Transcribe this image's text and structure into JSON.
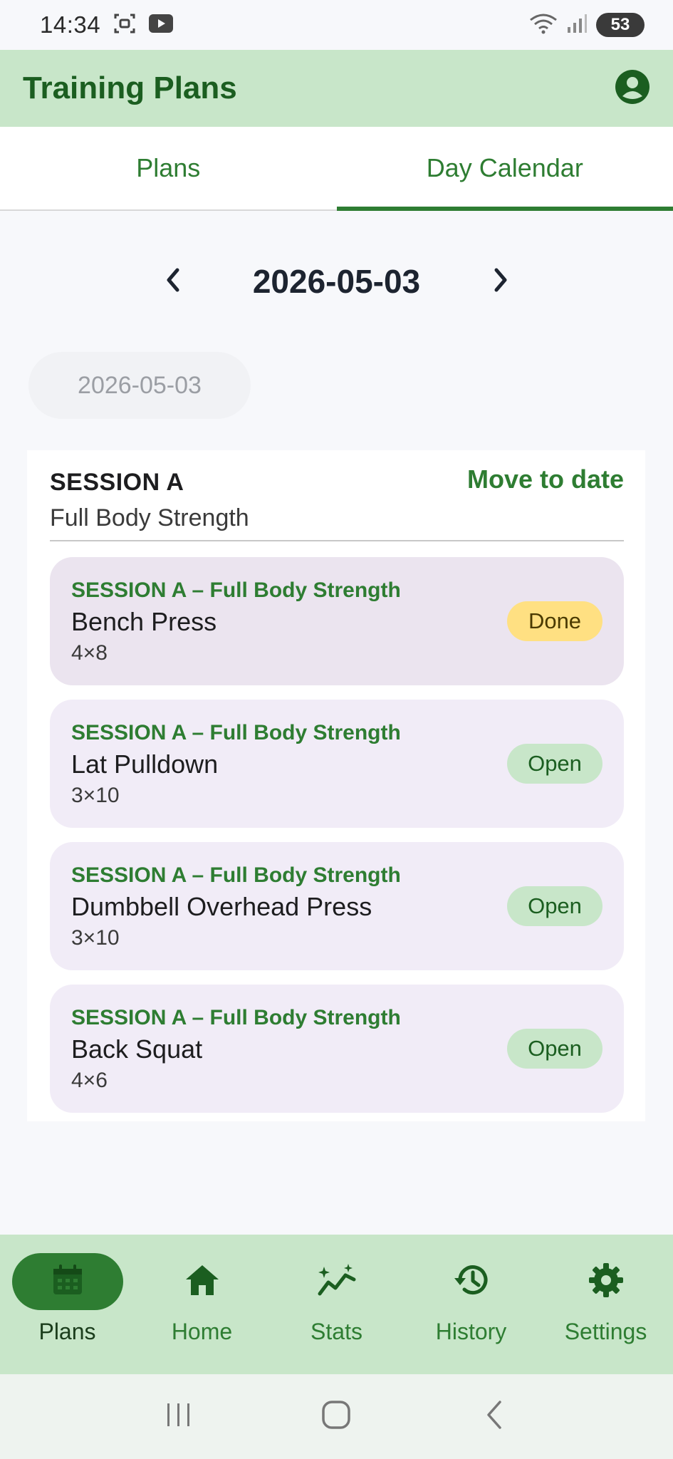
{
  "status_bar": {
    "time": "14:34",
    "battery": "53"
  },
  "app_bar": {
    "title": "Training Plans"
  },
  "tabs": [
    {
      "label": "Plans",
      "active": false
    },
    {
      "label": "Day Calendar",
      "active": true
    }
  ],
  "date_nav": {
    "current_date": "2026-05-03"
  },
  "date_chip": {
    "label": "2026-05-03"
  },
  "session": {
    "name": "SESSION A",
    "description": "Full Body Strength",
    "move_label": "Move to date",
    "exercises": [
      {
        "session_label": "SESSION A – Full Body Strength",
        "name": "Bench Press",
        "sets": "4×8",
        "status": "Done"
      },
      {
        "session_label": "SESSION A – Full Body Strength",
        "name": "Lat Pulldown",
        "sets": "3×10",
        "status": "Open"
      },
      {
        "session_label": "SESSION A – Full Body Strength",
        "name": "Dumbbell Overhead Press",
        "sets": "3×10",
        "status": "Open"
      },
      {
        "session_label": "SESSION A – Full Body Strength",
        "name": "Back Squat",
        "sets": "4×6",
        "status": "Open"
      }
    ]
  },
  "bottom_nav": {
    "items": [
      {
        "label": "Plans",
        "icon": "calendar-icon",
        "active": true
      },
      {
        "label": "Home",
        "icon": "home-icon",
        "active": false
      },
      {
        "label": "Stats",
        "icon": "stats-icon",
        "active": false
      },
      {
        "label": "History",
        "icon": "history-icon",
        "active": false
      },
      {
        "label": "Settings",
        "icon": "gear-icon",
        "active": false
      }
    ]
  },
  "colors": {
    "primary": "#2e7d32",
    "primary_dark": "#1b5e20",
    "app_bar_bg": "#c8e6c9",
    "done_badge": "#ffe082",
    "card_bg": "#f1ecf7"
  }
}
